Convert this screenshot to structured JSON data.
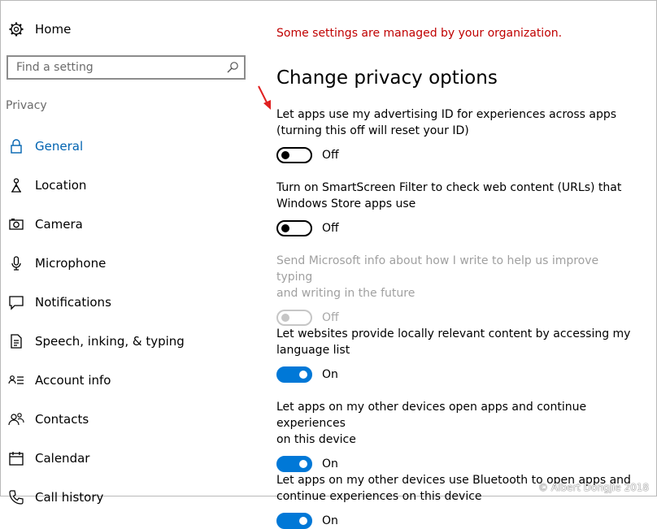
{
  "sidebar": {
    "home_label": "Home",
    "search_placeholder": "Find a setting",
    "section_label": "Privacy",
    "items": [
      {
        "label": "General",
        "icon": "lock-icon"
      },
      {
        "label": "Location",
        "icon": "location-person-icon"
      },
      {
        "label": "Camera",
        "icon": "camera-icon"
      },
      {
        "label": "Microphone",
        "icon": "microphone-icon"
      },
      {
        "label": "Notifications",
        "icon": "notification-icon"
      },
      {
        "label": "Speech, inking, & typing",
        "icon": "document-icon"
      },
      {
        "label": "Account info",
        "icon": "account-info-icon"
      },
      {
        "label": "Contacts",
        "icon": "contacts-icon"
      },
      {
        "label": "Calendar",
        "icon": "calendar-icon"
      },
      {
        "label": "Call history",
        "icon": "phone-icon"
      }
    ]
  },
  "main": {
    "notice": "Some settings are managed by your organization.",
    "heading": "Change privacy options",
    "settings": [
      {
        "desc1": "Let apps use my advertising ID for experiences across apps",
        "desc2": "(turning this off will reset your ID)",
        "state": "Off"
      },
      {
        "desc1": "Turn on SmartScreen Filter to check web content (URLs) that",
        "desc2": "Windows Store apps use",
        "state": "Off"
      },
      {
        "desc1": "Send Microsoft info about how I write to help us improve typing",
        "desc2": "and writing in the future",
        "state": "Off"
      },
      {
        "desc1": "Let websites provide locally relevant content by accessing my",
        "desc2": "language list",
        "state": "On"
      },
      {
        "desc1": "Let apps on my other devices open apps and continue experiences",
        "desc2": "on this device",
        "state": "On"
      },
      {
        "desc1": "Let apps on my other devices use Bluetooth to open apps and",
        "desc2": "continue experiences on this device",
        "state": "On"
      }
    ]
  },
  "watermark": "© Albert Dongjie 2018",
  "colors": {
    "accent": "#0078d7",
    "active_nav": "#0063b1",
    "notice": "#c00000",
    "arrow": "#e02020"
  }
}
